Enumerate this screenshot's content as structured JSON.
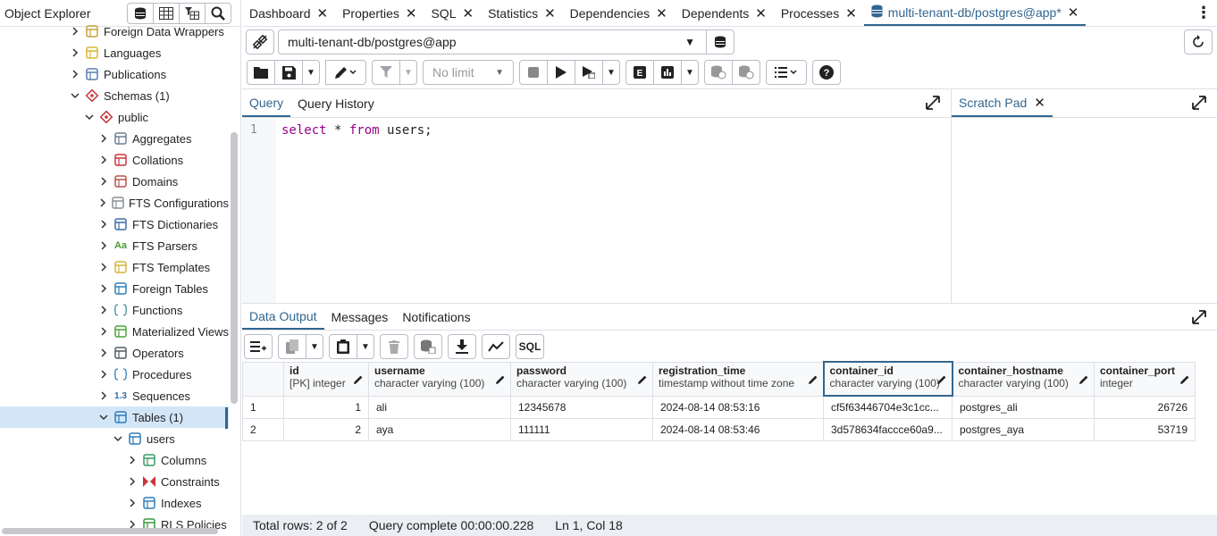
{
  "left": {
    "title": "Object Explorer",
    "tree": [
      {
        "label": "Foreign Data Wrappers",
        "indent": 76,
        "chev": ">",
        "icon": "foreign-data-wrapper-icon"
      },
      {
        "label": "Languages",
        "indent": 76,
        "chev": ">",
        "icon": "language-icon"
      },
      {
        "label": "Publications",
        "indent": 76,
        "chev": ">",
        "icon": "publication-icon"
      },
      {
        "label": "Schemas (1)",
        "indent": 76,
        "chev": "v",
        "icon": "schemas-icon"
      },
      {
        "label": "public",
        "indent": 92,
        "chev": "v",
        "icon": "schema-icon"
      },
      {
        "label": "Aggregates",
        "indent": 108,
        "chev": ">",
        "icon": "aggregate-icon"
      },
      {
        "label": "Collations",
        "indent": 108,
        "chev": ">",
        "icon": "collation-icon"
      },
      {
        "label": "Domains",
        "indent": 108,
        "chev": ">",
        "icon": "domain-icon"
      },
      {
        "label": "FTS Configurations",
        "indent": 108,
        "chev": ">",
        "icon": "fts-configuration-icon"
      },
      {
        "label": "FTS Dictionaries",
        "indent": 108,
        "chev": ">",
        "icon": "fts-dictionary-icon"
      },
      {
        "label": "FTS Parsers",
        "indent": 108,
        "chev": ">",
        "icon": "fts-parser-icon"
      },
      {
        "label": "FTS Templates",
        "indent": 108,
        "chev": ">",
        "icon": "fts-template-icon"
      },
      {
        "label": "Foreign Tables",
        "indent": 108,
        "chev": ">",
        "icon": "foreign-table-icon"
      },
      {
        "label": "Functions",
        "indent": 108,
        "chev": ">",
        "icon": "function-icon"
      },
      {
        "label": "Materialized Views",
        "indent": 108,
        "chev": ">",
        "icon": "materialized-view-icon"
      },
      {
        "label": "Operators",
        "indent": 108,
        "chev": ">",
        "icon": "operator-icon"
      },
      {
        "label": "Procedures",
        "indent": 108,
        "chev": ">",
        "icon": "procedure-icon"
      },
      {
        "label": "Sequences",
        "indent": 108,
        "chev": ">",
        "icon": "sequence-icon"
      },
      {
        "label": "Tables (1)",
        "indent": 108,
        "chev": "v",
        "icon": "tables-icon",
        "selected": true
      },
      {
        "label": "users",
        "indent": 124,
        "chev": "v",
        "icon": "table-icon"
      },
      {
        "label": "Columns",
        "indent": 140,
        "chev": ">",
        "icon": "columns-icon"
      },
      {
        "label": "Constraints",
        "indent": 140,
        "chev": ">",
        "icon": "constraints-icon"
      },
      {
        "label": "Indexes",
        "indent": 140,
        "chev": ">",
        "icon": "indexes-icon"
      },
      {
        "label": "RLS Policies",
        "indent": 140,
        "chev": ">",
        "icon": "rls-policy-icon"
      }
    ]
  },
  "tabs": [
    {
      "label": "Dashboard"
    },
    {
      "label": "Properties"
    },
    {
      "label": "SQL"
    },
    {
      "label": "Statistics"
    },
    {
      "label": "Dependencies"
    },
    {
      "label": "Dependents"
    },
    {
      "label": "Processes"
    },
    {
      "label": "multi-tenant-db/postgres@app*",
      "active": true
    }
  ],
  "connection": {
    "value": "multi-tenant-db/postgres@app"
  },
  "toolbar": {
    "limit": "No limit"
  },
  "editor": {
    "tabs": [
      "Query",
      "Query History"
    ],
    "line_number": "1",
    "code": {
      "kw1": "select",
      "star": " * ",
      "kw2": "from",
      "rest": " users;"
    }
  },
  "scratch": {
    "title": "Scratch Pad"
  },
  "output": {
    "tabs": [
      "Data Output",
      "Messages",
      "Notifications"
    ],
    "sql_button": "SQL",
    "columns": [
      {
        "name": "id",
        "type": "[PK] integer"
      },
      {
        "name": "username",
        "type": "character varying (100)"
      },
      {
        "name": "password",
        "type": "character varying (100)"
      },
      {
        "name": "registration_time",
        "type": "timestamp without time zone"
      },
      {
        "name": "container_id",
        "type": "character varying (100)"
      },
      {
        "name": "container_hostname",
        "type": "character varying (100)"
      },
      {
        "name": "container_port",
        "type": "integer"
      }
    ],
    "rows": [
      [
        "1",
        "1",
        "ali",
        "12345678",
        "2024-08-14 08:53:16",
        "cf5f63446704e3c1cc...",
        "postgres_ali",
        "26726"
      ],
      [
        "2",
        "2",
        "aya",
        "111111",
        "2024-08-14 08:53:46",
        "3d578634faccce60a9...",
        "postgres_aya",
        "53719"
      ]
    ]
  },
  "status": {
    "rows": "Total rows: 2 of 2",
    "query": "Query complete 00:00:00.228",
    "position": "Ln 1, Col 18"
  }
}
